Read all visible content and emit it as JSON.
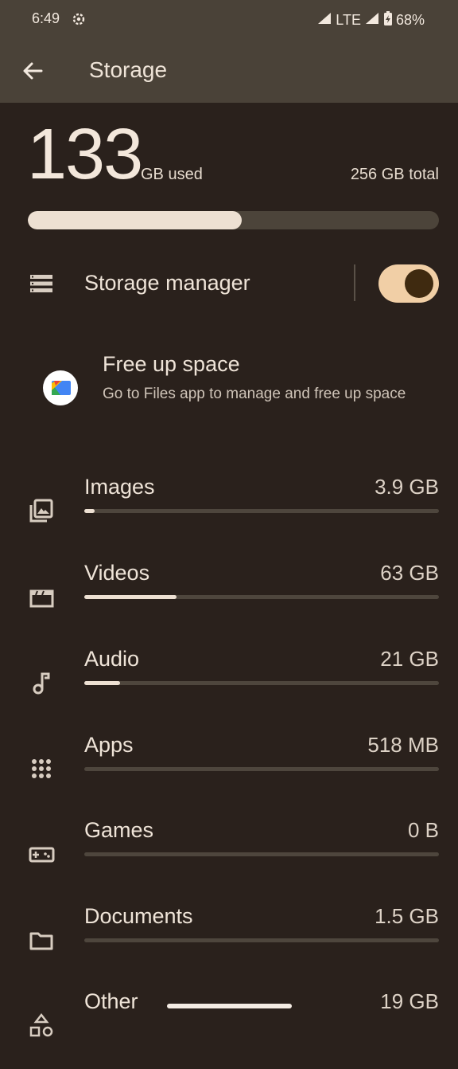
{
  "status_bar": {
    "time": "6:49",
    "network": "LTE",
    "battery": "68%"
  },
  "app_bar": {
    "title": "Storage"
  },
  "summary": {
    "used": "133",
    "used_unit": "GB used",
    "total": "256 GB total",
    "used_fraction": 0.52
  },
  "storage_manager": {
    "label": "Storage manager",
    "enabled": true
  },
  "free_up": {
    "title": "Free up space",
    "subtitle": "Go to Files app to manage and free up space"
  },
  "categories": [
    {
      "label": "Images",
      "size": "3.9 GB",
      "fraction": 0.03,
      "icon": "images-icon"
    },
    {
      "label": "Videos",
      "size": "63 GB",
      "fraction": 0.26,
      "icon": "video-icon"
    },
    {
      "label": "Audio",
      "size": "21 GB",
      "fraction": 0.1,
      "icon": "music-note-icon"
    },
    {
      "label": "Apps",
      "size": "518 MB",
      "fraction": 0.0,
      "icon": "apps-grid-icon"
    },
    {
      "label": "Games",
      "size": "0 B",
      "fraction": 0.0,
      "icon": "gamepad-icon"
    },
    {
      "label": "Documents",
      "size": "1.5 GB",
      "fraction": 0.0,
      "icon": "folder-icon"
    },
    {
      "label": "Other",
      "size": "19 GB",
      "fraction": 0.0,
      "icon": "shapes-icon"
    }
  ],
  "colors": {
    "background": "#2a211c",
    "header": "#4a4238",
    "accent": "#f1cfa6",
    "fill": "#ede0d2"
  }
}
